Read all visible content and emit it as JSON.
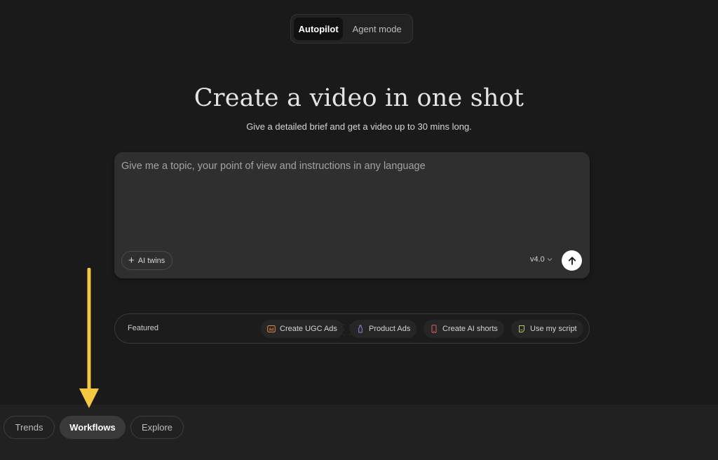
{
  "mode_toggle": {
    "active_label": "Autopilot",
    "inactive_label": "Agent mode"
  },
  "hero": {
    "title": "Create a video in one shot",
    "subtitle": "Give a detailed brief and get a video up to 30 mins long."
  },
  "prompt": {
    "placeholder": "Give me a topic, your point of view and instructions in any language",
    "value": "",
    "ai_twins_label": "AI twins",
    "version_label": "v4.0",
    "icons": {
      "plus": "plus-icon",
      "chevron": "chevron-down-icon",
      "send": "arrow-up-icon"
    }
  },
  "featured": {
    "label": "Featured",
    "chips": [
      {
        "label": "Create UGC Ads",
        "icon": "ad-icon",
        "color": "#e0884a"
      },
      {
        "label": "Product Ads",
        "icon": "bottle-icon",
        "color": "#9b7fe0"
      },
      {
        "label": "Create AI shorts",
        "icon": "phone-icon",
        "color": "#e06060"
      },
      {
        "label": "Use my script",
        "icon": "script-icon",
        "color": "#b8c86a"
      }
    ]
  },
  "bottom_tabs": [
    {
      "label": "Trends",
      "active": false
    },
    {
      "label": "Workflows",
      "active": true
    },
    {
      "label": "Explore",
      "active": false
    }
  ],
  "annotation": {
    "arrow_color": "#f5c842"
  }
}
